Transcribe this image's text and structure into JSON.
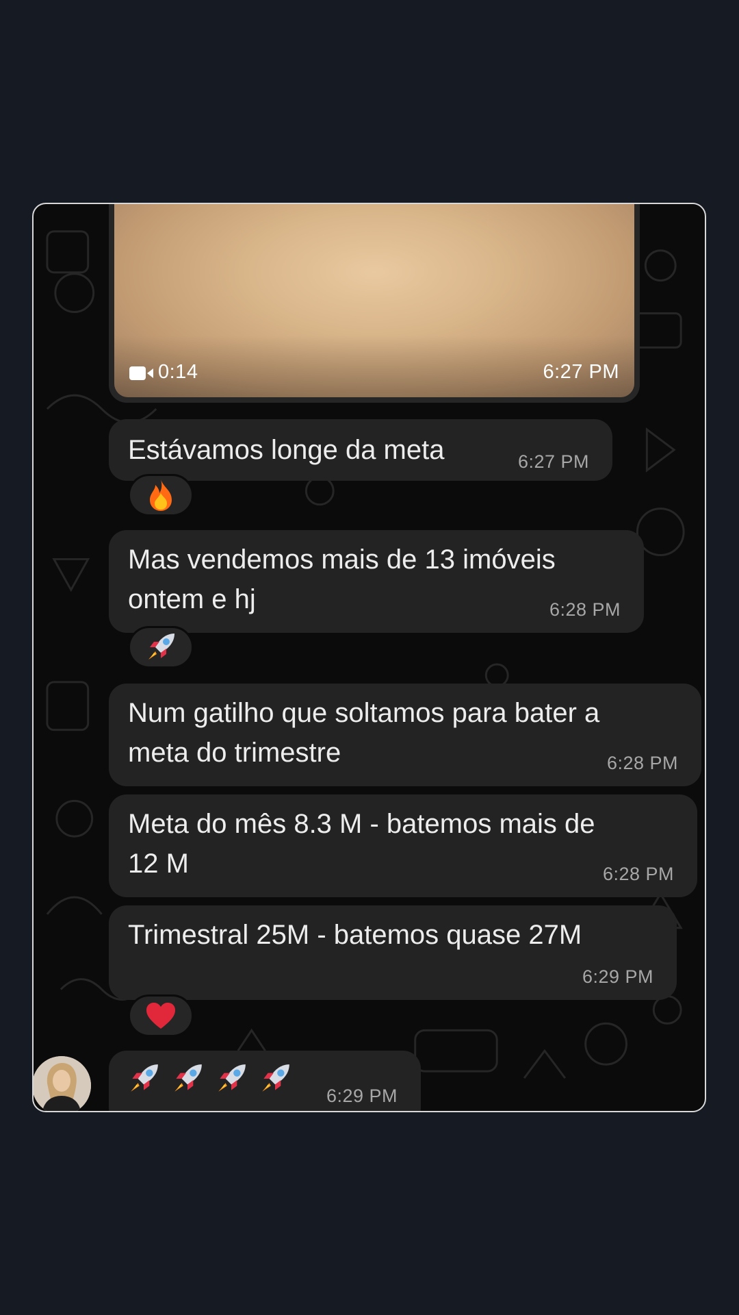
{
  "video": {
    "duration": "0:14",
    "time": "6:27 PM"
  },
  "messages": [
    {
      "text": "Estávamos longe da meta",
      "time": "6:27 PM",
      "reaction": "fire"
    },
    {
      "text": "Mas vendemos mais de 13 imóveis\nontem e hj",
      "time": "6:28 PM",
      "reaction": "rocket"
    },
    {
      "text": "Num gatilho que soltamos para bater a\nmeta do trimestre",
      "time": "6:28 PM"
    },
    {
      "text": "Meta do mês 8.3 M - batemos mais de\n12 M",
      "time": "6:28 PM"
    },
    {
      "text": "Trimestral 25M - batemos quase 27M",
      "time": "6:29 PM",
      "reaction": "heart"
    },
    {
      "emojis": [
        "rocket",
        "rocket",
        "rocket",
        "rocket"
      ],
      "time": "6:29 PM"
    }
  ],
  "colors": {
    "page_background": "#161a23",
    "chat_background": "#0b0b0b",
    "bubble": "#232323",
    "text": "#ededed",
    "timestamp": "#a7a7a7"
  }
}
